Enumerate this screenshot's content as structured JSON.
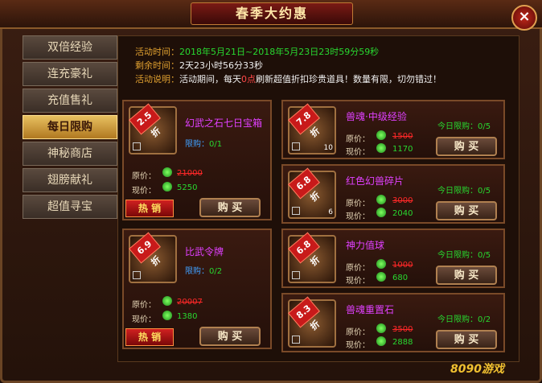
{
  "title": "春季大约惠",
  "close_label": "×",
  "sidebar": {
    "items": [
      {
        "label": "双倍经验"
      },
      {
        "label": "连充豪礼"
      },
      {
        "label": "充值售礼"
      },
      {
        "label": "每日限购",
        "active": true
      },
      {
        "label": "神秘商店"
      },
      {
        "label": "翅膀献礼"
      },
      {
        "label": "超值寻宝"
      }
    ]
  },
  "info": {
    "time_label": "活动时间：",
    "time_value": "2018年5月21日~2018年5月23日23时59分59秒",
    "remain_label": "剩余时间：",
    "remain_value": "2天23小时56分33秒",
    "desc_label": "活动说明：",
    "desc_pre": "活动期间，每天",
    "desc_hl": "0点",
    "desc_post": "刷新超值折扣珍贵道具！数量有限，切勿错过！"
  },
  "labels": {
    "orig": "原价：",
    "now": "现价：",
    "limit": "限购：",
    "today_limit": "今日限购：",
    "buy": "购 买",
    "hot": "热 销"
  },
  "cards": [
    {
      "discount": "2.5折",
      "name": "幻武之石七日宝箱",
      "limit": "0/1",
      "orig_price": "21000",
      "now_price": "5250",
      "qty": ""
    },
    {
      "discount": "6.9折",
      "name": "比武令牌",
      "limit": "0/2",
      "orig_price": "20007",
      "now_price": "1380",
      "qty": ""
    },
    {
      "discount": "7.8折",
      "name": "兽魂·中级经验",
      "limit": "0/5",
      "orig_price": "1500",
      "now_price": "1170",
      "qty": "10"
    },
    {
      "discount": "6.8折",
      "name": "红色幻兽碎片",
      "limit": "0/5",
      "orig_price": "3000",
      "now_price": "2040",
      "qty": "6"
    },
    {
      "discount": "6.8折",
      "name": "神力值球",
      "limit": "0/5",
      "orig_price": "1000",
      "now_price": "680",
      "qty": ""
    },
    {
      "discount": "8.3折",
      "name": "兽魂重置石",
      "limit": "0/2",
      "orig_price": "3500",
      "now_price": "2888",
      "qty": ""
    }
  ],
  "watermark": "8090游戏"
}
